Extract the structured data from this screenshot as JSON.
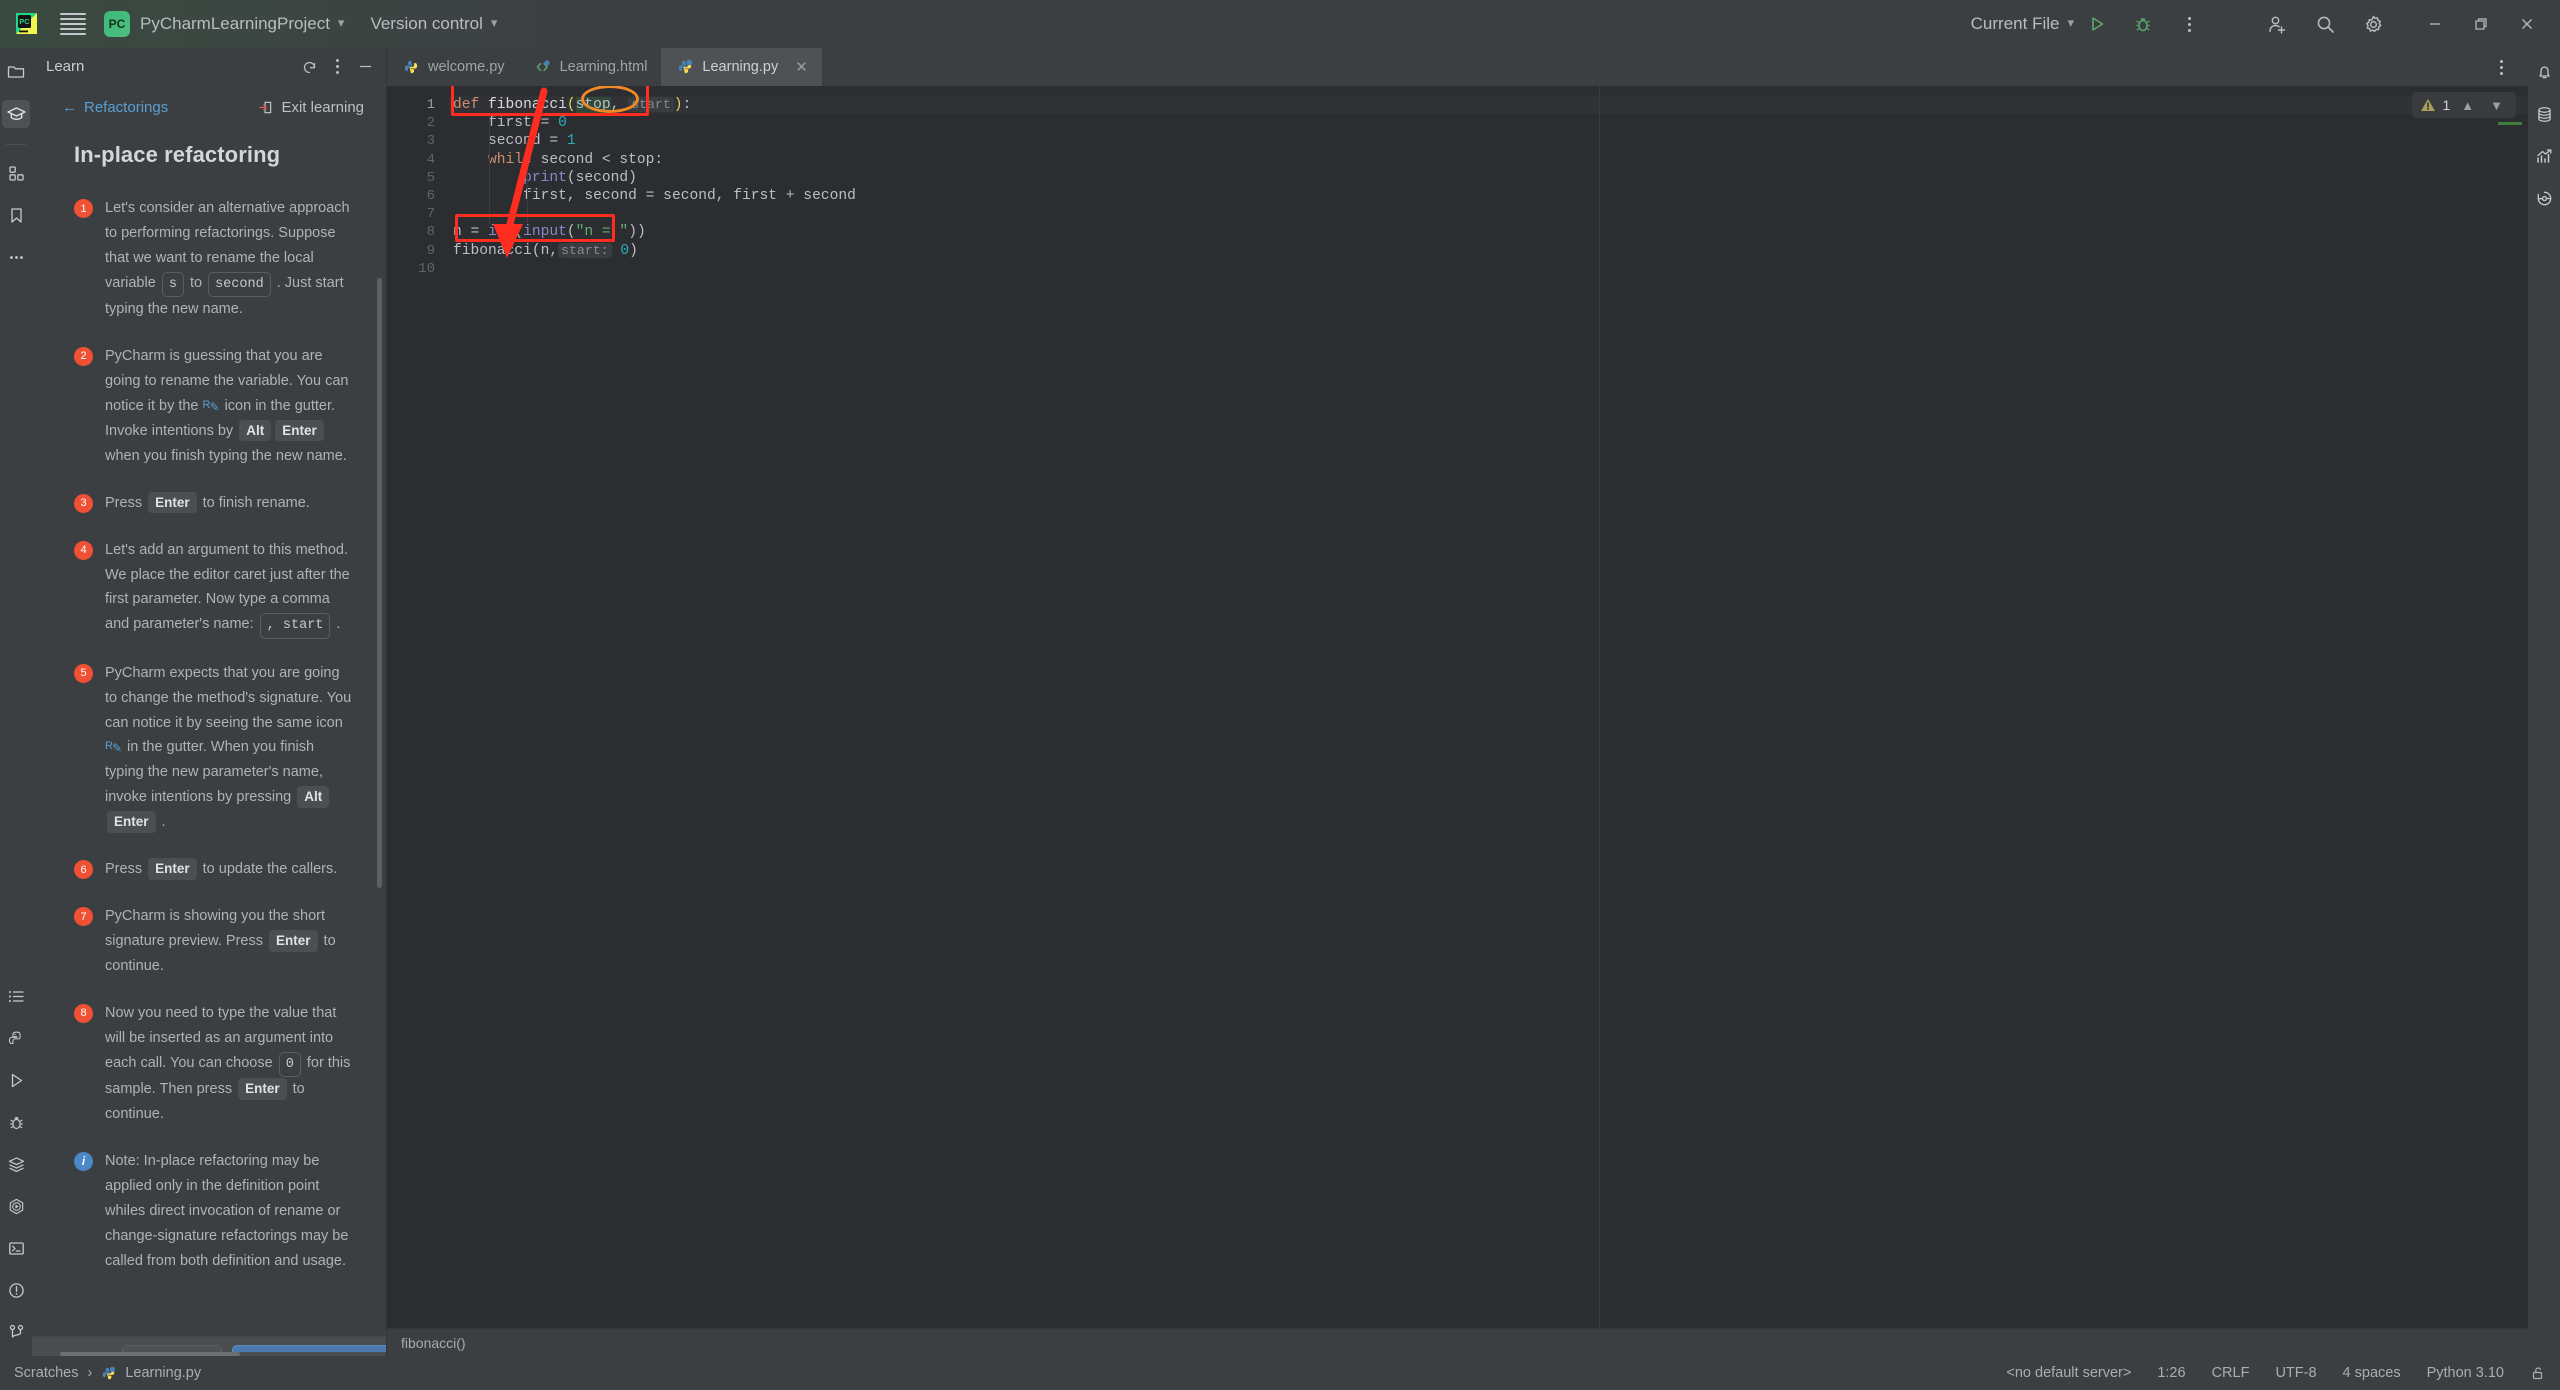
{
  "titlebar": {
    "menu_icon": "hamburger-menu-icon",
    "project_badge": "PC",
    "project_name": "PyCharmLearningProject",
    "version_control": "Version control",
    "run_config": "Current File",
    "run_icon": "run-icon",
    "debug_icon": "debug-icon",
    "more_icon": "more-actions-icon",
    "account_icon": "add-account-icon",
    "search_icon": "search-icon",
    "settings_icon": "settings-gear-icon",
    "minimize": "minimize-icon",
    "maximize": "maximize-icon",
    "close": "close-icon"
  },
  "left_rail": {
    "top_items": [
      {
        "name": "project-tool-icon",
        "label": "Project"
      },
      {
        "name": "learn-tool-icon",
        "label": "Learn",
        "active": true
      },
      {
        "name": "structure-tool-icon",
        "label": "Structure"
      },
      {
        "name": "bookmarks-tool-icon",
        "label": "Bookmarks"
      },
      {
        "name": "more-tool-windows-icon",
        "label": "More tool windows"
      }
    ],
    "bottom_items": [
      {
        "name": "todo-tool-icon",
        "label": "TODO"
      },
      {
        "name": "python-packages-icon",
        "label": "Python Packages"
      },
      {
        "name": "run-tool-icon",
        "label": "Run"
      },
      {
        "name": "debug-tool-icon",
        "label": "Debug"
      },
      {
        "name": "services-tool-icon",
        "label": "Services"
      },
      {
        "name": "python-console-icon",
        "label": "Python Console"
      },
      {
        "name": "terminal-tool-icon",
        "label": "Terminal"
      },
      {
        "name": "problems-tool-icon",
        "label": "Problems"
      },
      {
        "name": "version-control-tool-icon",
        "label": "Version Control"
      }
    ]
  },
  "right_rail": {
    "items": [
      {
        "name": "notifications-icon",
        "label": "Notifications"
      },
      {
        "name": "database-icon",
        "label": "Database"
      },
      {
        "name": "profiler-icon",
        "label": "Profiler"
      },
      {
        "name": "history-icon",
        "label": "History"
      }
    ]
  },
  "learn_panel": {
    "title": "Learn",
    "header_icons": [
      {
        "name": "restart-lesson-icon"
      },
      {
        "name": "options-icon"
      },
      {
        "name": "hide-panel-icon"
      }
    ],
    "back_link": "Refactorings",
    "exit_link": "Exit learning",
    "lesson_title": "In-place refactoring",
    "steps": [
      {
        "number": "1",
        "kind": "step",
        "parts": [
          {
            "t": "text",
            "v": "Let's consider an alternative approach to performing refactorings. Suppose that we want to rename the local variable "
          },
          {
            "t": "code",
            "v": "s"
          },
          {
            "t": "text",
            "v": " to "
          },
          {
            "t": "code",
            "v": "second"
          },
          {
            "t": "text",
            "v": " . Just start typing the new name."
          }
        ]
      },
      {
        "number": "2",
        "kind": "step",
        "parts": [
          {
            "t": "text",
            "v": "PyCharm is guessing that you are going to rename the variable. You can notice it by the "
          },
          {
            "t": "icon",
            "v": "refactor-gutter-icon"
          },
          {
            "t": "text",
            "v": " icon in the gutter. Invoke intentions by "
          },
          {
            "t": "kbd",
            "v": "Alt"
          },
          {
            "t": "kbd",
            "v": "Enter"
          },
          {
            "t": "text",
            "v": " when you finish typing the new name."
          }
        ]
      },
      {
        "number": "3",
        "kind": "step",
        "parts": [
          {
            "t": "text",
            "v": "Press "
          },
          {
            "t": "kbd",
            "v": "Enter"
          },
          {
            "t": "text",
            "v": " to finish rename."
          }
        ]
      },
      {
        "number": "4",
        "kind": "step",
        "parts": [
          {
            "t": "text",
            "v": "Let's add an argument to this method. We place the editor caret just after the first parameter. Now type a comma and parameter's name: "
          },
          {
            "t": "code",
            "v": ", start"
          },
          {
            "t": "text",
            "v": " ."
          }
        ]
      },
      {
        "number": "5",
        "kind": "step",
        "parts": [
          {
            "t": "text",
            "v": "PyCharm expects that you are going to change the method's signature. You can notice it by seeing the same icon "
          },
          {
            "t": "icon",
            "v": "refactor-gutter-icon"
          },
          {
            "t": "text",
            "v": " in the gutter. When you finish typing the new parameter's name, invoke intentions by pressing "
          },
          {
            "t": "kbd",
            "v": "Alt"
          },
          {
            "t": "kbd",
            "v": "Enter"
          },
          {
            "t": "text",
            "v": " ."
          }
        ]
      },
      {
        "number": "6",
        "kind": "step",
        "parts": [
          {
            "t": "text",
            "v": "Press "
          },
          {
            "t": "kbd",
            "v": "Enter"
          },
          {
            "t": "text",
            "v": " to update the callers."
          }
        ]
      },
      {
        "number": "7",
        "kind": "step",
        "parts": [
          {
            "t": "text",
            "v": "PyCharm is showing you the short signature preview. Press "
          },
          {
            "t": "kbd",
            "v": "Enter"
          },
          {
            "t": "text",
            "v": " to continue."
          }
        ]
      },
      {
        "number": "8",
        "kind": "step",
        "parts": [
          {
            "t": "text",
            "v": "Now you need to type the value that will be inserted as an argument into each call. You can choose "
          },
          {
            "t": "code",
            "v": "0"
          },
          {
            "t": "text",
            "v": " for this sample. Then press "
          },
          {
            "t": "kbd",
            "v": "Enter"
          },
          {
            "t": "text",
            "v": " to continue."
          }
        ]
      },
      {
        "number": "i",
        "kind": "note",
        "parts": [
          {
            "t": "text",
            "v": "Note: In-place refactoring may be applied only in the definition point whiles direct invocation of rename or change-signature refactorings may be called from both definition and usage."
          }
        ]
      }
    ]
  },
  "editor": {
    "tabs": [
      {
        "label": "welcome.py",
        "icon": "python-file-icon",
        "active": false,
        "closable": false
      },
      {
        "label": "Learning.html",
        "icon": "html-file-icon",
        "active": false,
        "closable": false
      },
      {
        "label": "Learning.py",
        "icon": "python-scratch-file-icon",
        "active": true,
        "closable": true
      }
    ],
    "tabs_more_icon": "editor-options-icon",
    "line_numbers": [
      "1",
      "2",
      "3",
      "4",
      "5",
      "6",
      "7",
      "8",
      "9",
      "10"
    ],
    "current_line": 1,
    "code_lines": [
      [
        {
          "t": "kw",
          "v": "def"
        },
        {
          "t": "plain",
          "v": " "
        },
        {
          "t": "fn",
          "v": "fibonacci"
        },
        {
          "t": "paren",
          "v": "("
        },
        {
          "t": "tmplvar",
          "v": "stop"
        },
        {
          "t": "plain",
          "v": ", "
        },
        {
          "t": "hintvar",
          "v": "start"
        },
        {
          "t": "paren",
          "v": ")"
        },
        {
          "t": "plain",
          "v": ":"
        }
      ],
      [
        {
          "t": "plain",
          "v": "    first = "
        },
        {
          "t": "num",
          "v": "0"
        }
      ],
      [
        {
          "t": "plain",
          "v": "    second = "
        },
        {
          "t": "num",
          "v": "1"
        }
      ],
      [
        {
          "t": "plain",
          "v": "    "
        },
        {
          "t": "kw",
          "v": "while"
        },
        {
          "t": "plain",
          "v": " second < stop:"
        }
      ],
      [
        {
          "t": "plain",
          "v": "        "
        },
        {
          "t": "bi",
          "v": "print"
        },
        {
          "t": "plain",
          "v": "(second)"
        }
      ],
      [
        {
          "t": "plain",
          "v": "        first, second = second, first + second"
        }
      ],
      [
        {
          "t": "plain",
          "v": ""
        }
      ],
      [
        {
          "t": "plain",
          "v": "n = "
        },
        {
          "t": "bi",
          "v": "int"
        },
        {
          "t": "plain",
          "v": "("
        },
        {
          "t": "bi",
          "v": "input"
        },
        {
          "t": "plain",
          "v": "("
        },
        {
          "t": "str",
          "v": "\"n = \""
        },
        {
          "t": "plain",
          "v": "))"
        }
      ],
      [
        {
          "t": "plain",
          "v": "fibonacci(n,"
        },
        {
          "t": "hintlabel",
          "v": "start:"
        },
        {
          "t": "num",
          "v": " 0"
        },
        {
          "t": "plain",
          "v": ")"
        }
      ],
      [
        {
          "t": "plain",
          "v": ""
        }
      ]
    ],
    "inspection_widget": {
      "warning_icon": "warning-triangle-icon",
      "warning_count": "1",
      "prev_icon": "chevron-up-icon",
      "next_icon": "chevron-down-icon"
    },
    "annotations": [
      {
        "name": "signature-highlight-rect",
        "shape": "rect"
      },
      {
        "name": "start-parameter-ellipse",
        "shape": "ellipse"
      },
      {
        "name": "call-site-highlight-rect",
        "shape": "rect"
      },
      {
        "name": "pointer-arrow",
        "shape": "arrow"
      }
    ],
    "breadcrumb": "fibonacci()"
  },
  "statusbar": {
    "left_crumbs": [
      "Scratches",
      "Learning.py"
    ],
    "left_file_icon": "python-scratch-file-icon",
    "separator": "›",
    "right_items": [
      "<no default server>",
      "1:26",
      "CRLF",
      "UTF-8",
      "4 spaces",
      "Python 3.10"
    ],
    "lock_icon": "unlocked-icon"
  },
  "colors": {
    "accent_red": "#f05033",
    "accent_blue": "#5a9fd4",
    "anno_red": "#ff2d1f",
    "anno_orange": "#f08a24",
    "editor_bg": "#2b2d30",
    "panel_bg": "#3c3f41",
    "run_green": "#59a869"
  }
}
